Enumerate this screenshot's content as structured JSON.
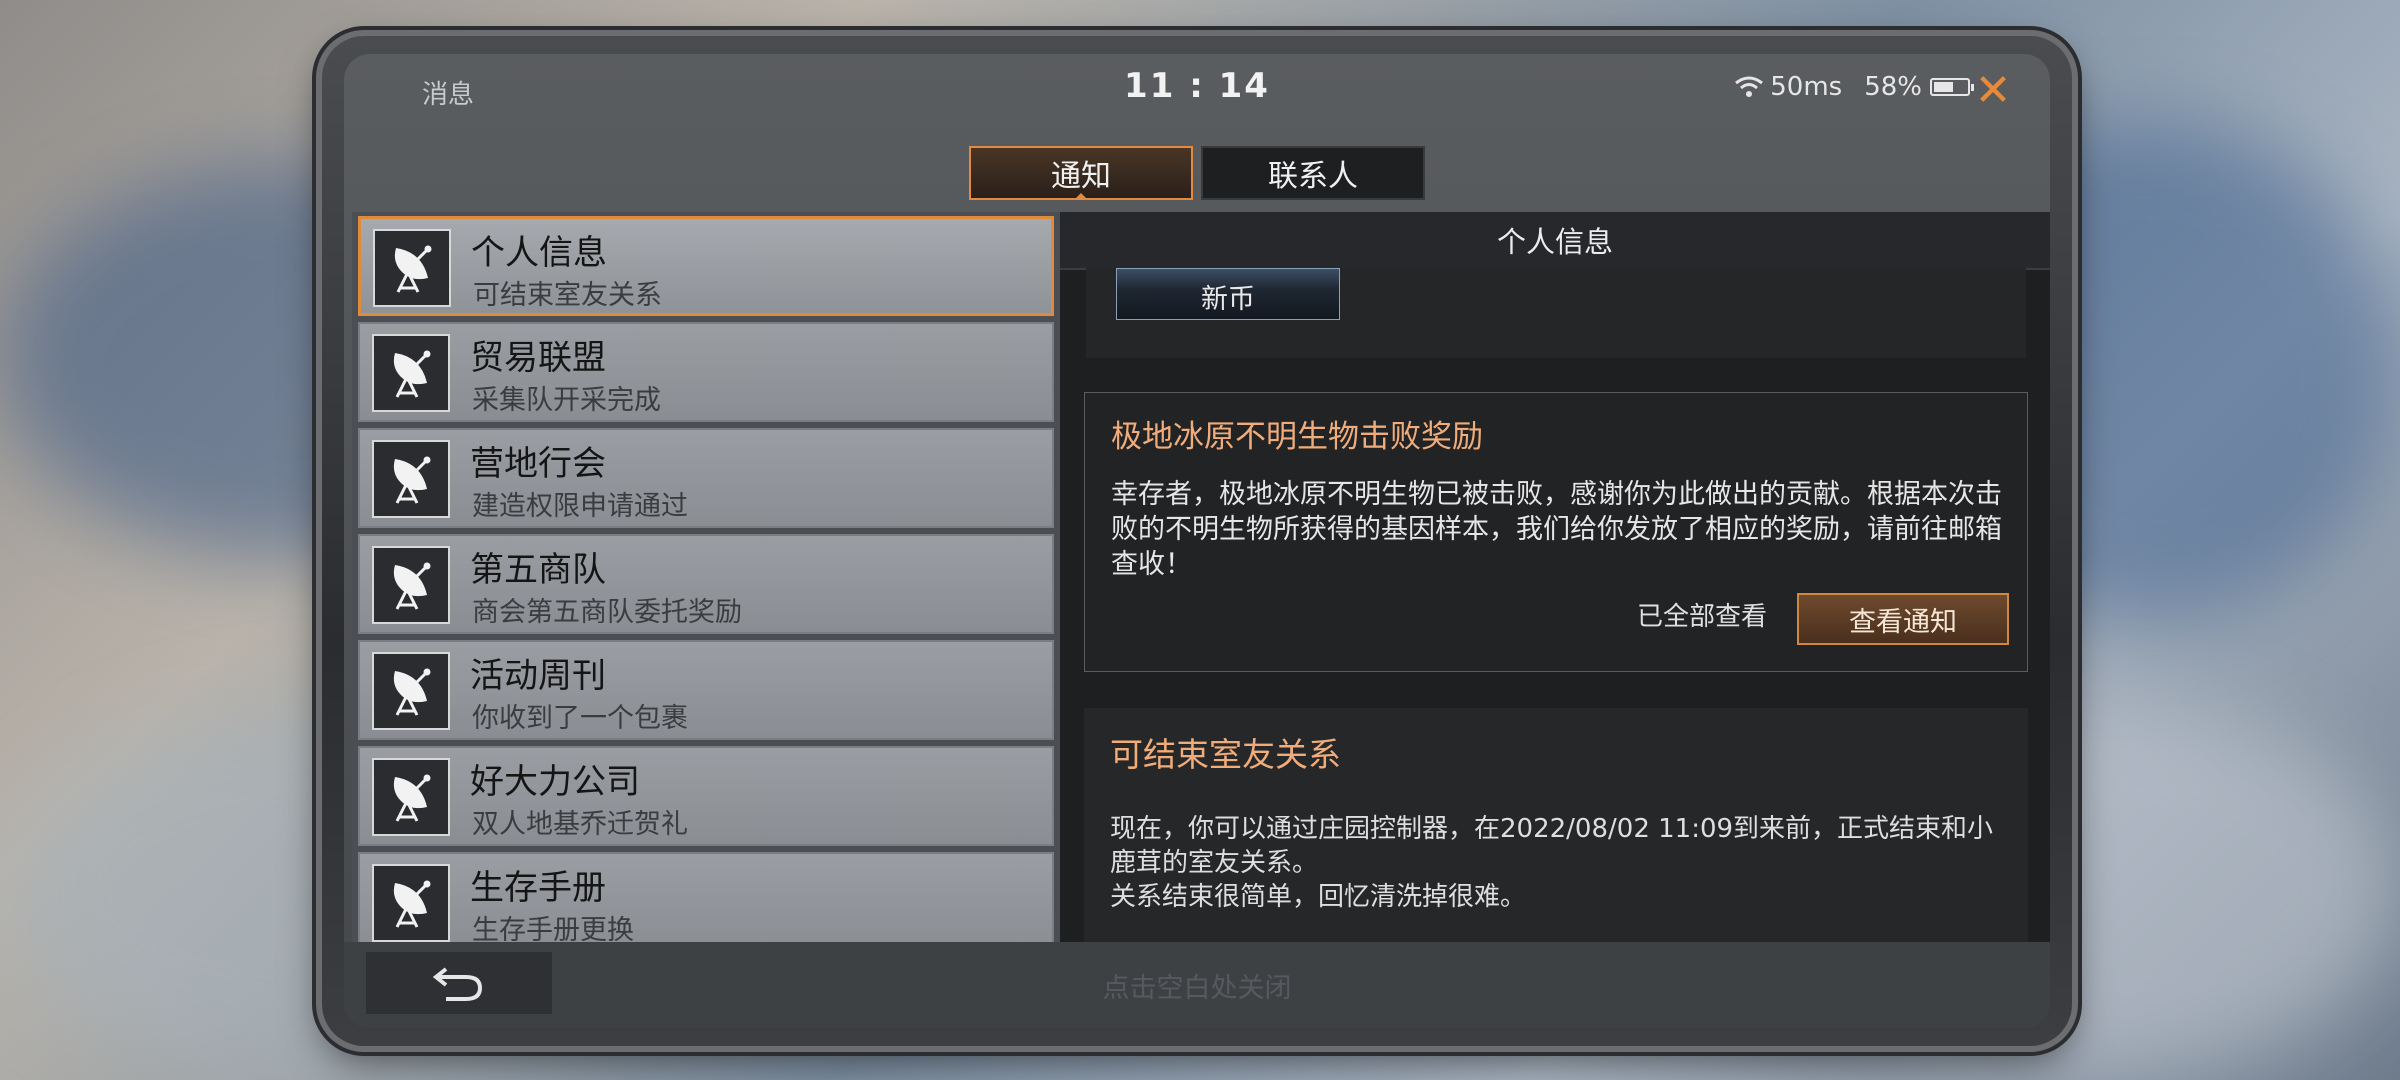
{
  "status_bar": {
    "title": "消息",
    "time": "11 : 14",
    "ping": "50ms",
    "battery_text": "58%",
    "battery_level": 0.58
  },
  "tabs": [
    {
      "label": "通知",
      "active": true
    },
    {
      "label": "联系人",
      "active": false
    }
  ],
  "notifications": [
    {
      "title": "个人信息",
      "subtitle": "可结束室友关系",
      "icon": "satellite-dish-icon",
      "selected": true
    },
    {
      "title": "贸易联盟",
      "subtitle": "采集队开采完成",
      "icon": "satellite-dish-icon"
    },
    {
      "title": "营地行会",
      "subtitle": "建造权限申请通过",
      "icon": "satellite-dish-icon"
    },
    {
      "title": "第五商队",
      "subtitle": "商会第五商队委托奖励",
      "icon": "satellite-dish-icon"
    },
    {
      "title": "活动周刊",
      "subtitle": "你收到了一个包裹",
      "icon": "satellite-dish-icon"
    },
    {
      "title": "好大力公司",
      "subtitle": "双人地基乔迁贺礼",
      "icon": "satellite-dish-icon"
    },
    {
      "title": "生存手册",
      "subtitle": "生存手册更换",
      "icon": "satellite-dish-icon"
    }
  ],
  "detail": {
    "header": "个人信息",
    "coin_label": "新币",
    "card1": {
      "title": "极地冰原不明生物击败奖励",
      "body": "幸存者，极地冰原不明生物已被击败，感谢你为此做出的贡献。根据本次击败的不明生物所获得的基因样本，我们给你发放了相应的奖励，请前往邮箱查收！",
      "viewed_label": "已全部查看",
      "button_label": "查看通知"
    },
    "card2": {
      "title": "可结束室友关系",
      "body_line1": "现在，你可以通过庄园控制器，在2022/08/02 11:09到来前，正式结束和小鹿茸的室友关系。",
      "body_line2": "关系结束很简单，回忆清洗掉很难。"
    }
  },
  "bottom_bar": {
    "back_icon": "back-arrow-icon",
    "close_hint": "点击空白处关闭"
  },
  "colors": {
    "accent": "#e08a3c",
    "title_orange": "#f0ac7a",
    "close_orange": "#e98a3a"
  }
}
